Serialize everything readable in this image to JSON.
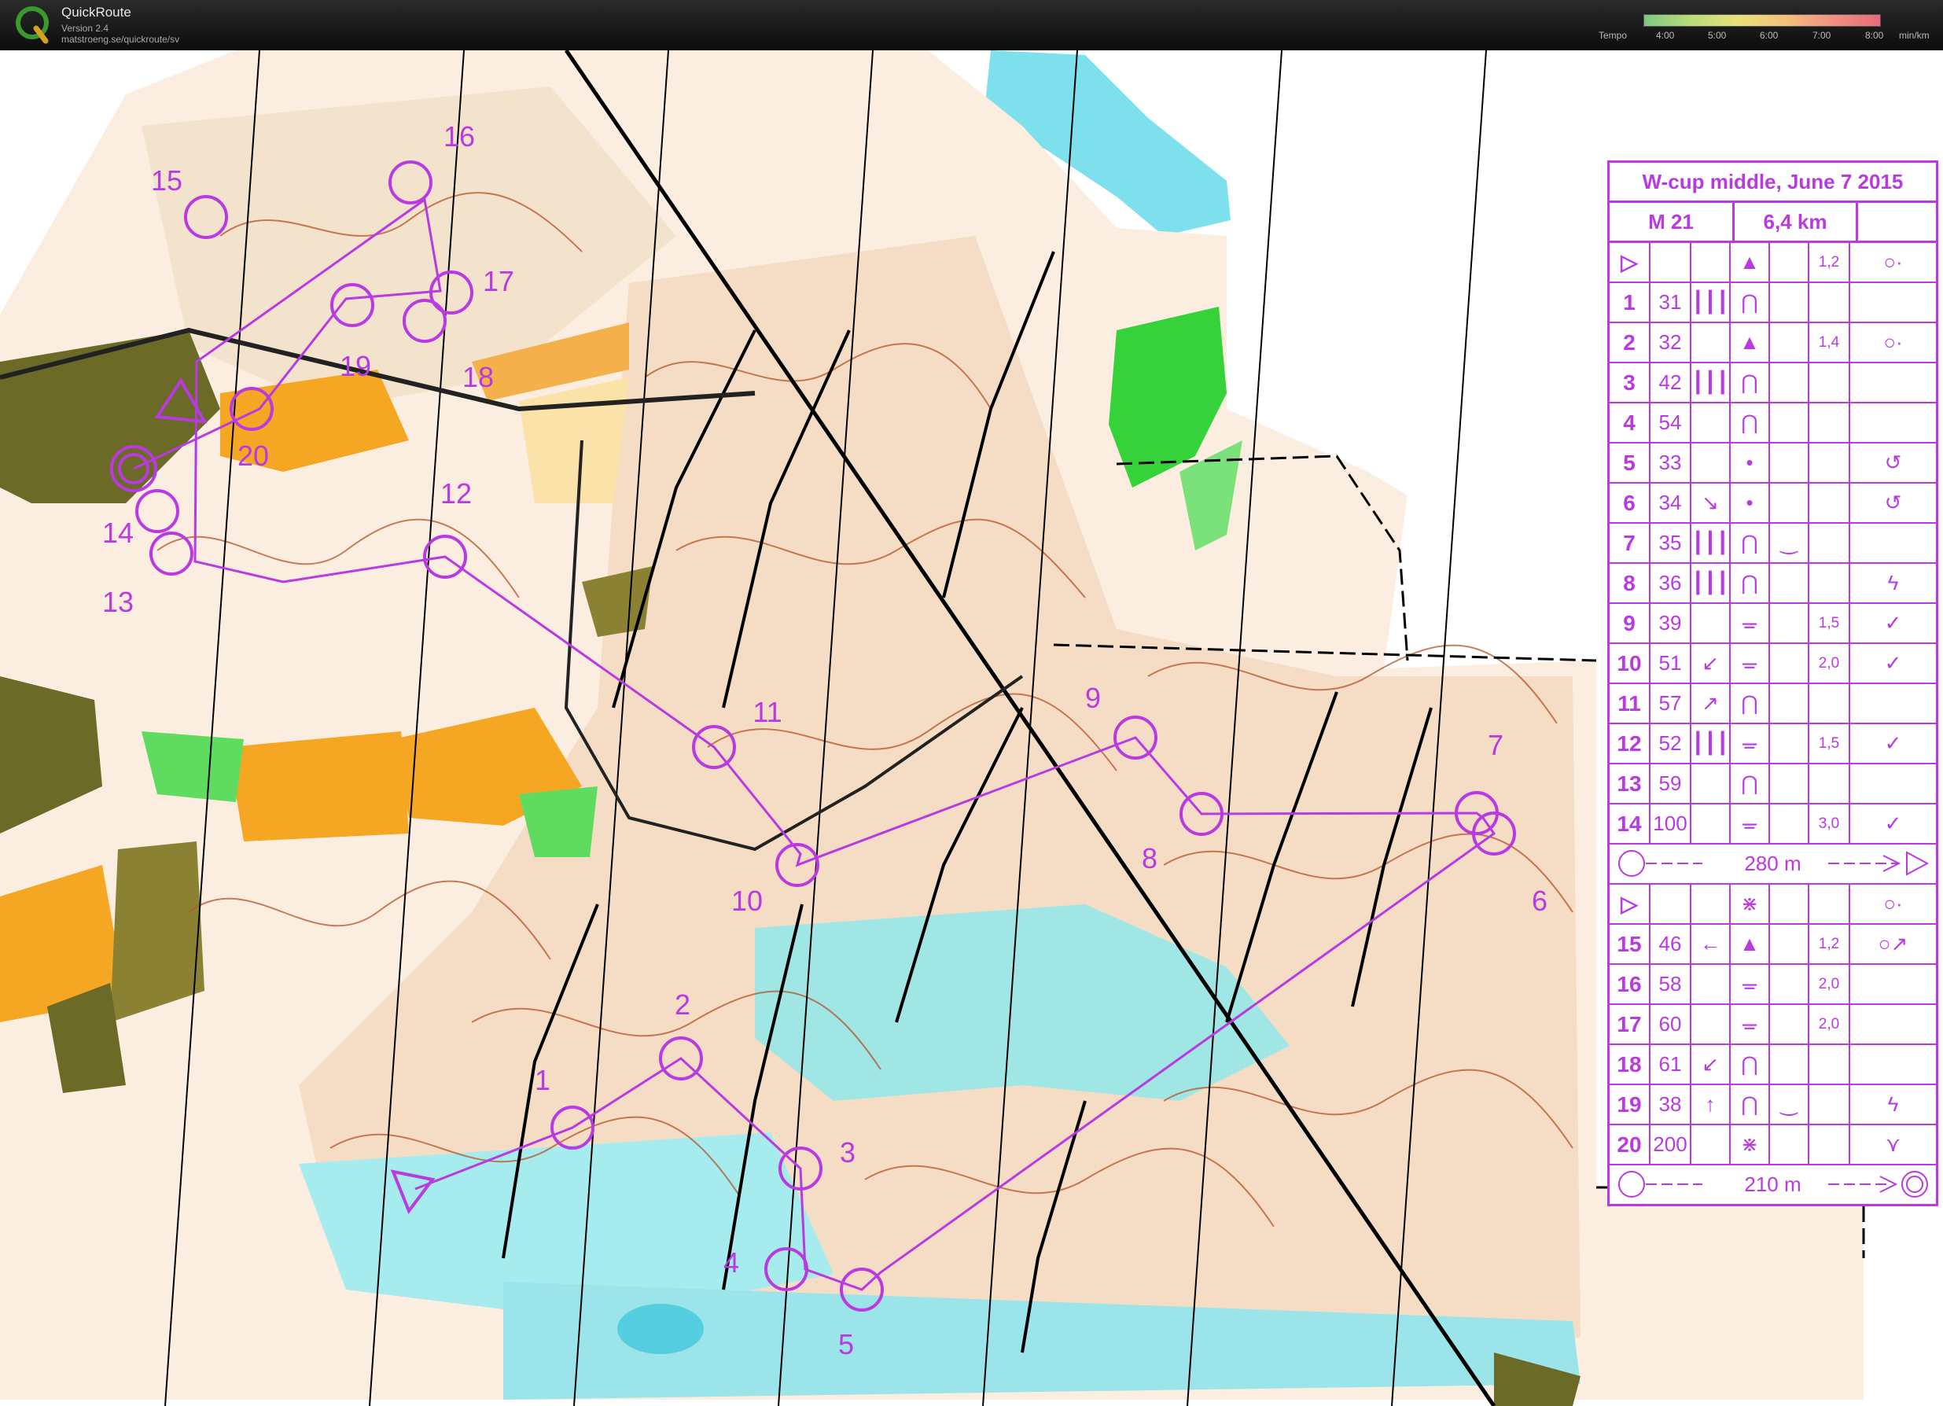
{
  "app": {
    "name": "QuickRoute",
    "version": "Version 2.4",
    "url": "matstroeng.se/quickroute/sv",
    "logo_letter": "Q"
  },
  "tempo": {
    "label": "Tempo",
    "ticks": [
      "4:00",
      "5:00",
      "6:00",
      "7:00",
      "8:00"
    ],
    "unit": "min/km",
    "gradient_colors": [
      "#7fc87f",
      "#b9dc7a",
      "#eae07a",
      "#f4c07a",
      "#f09080",
      "#e86a7a"
    ]
  },
  "map": {
    "colors": {
      "course": "#b83ae0",
      "open_land": "#f5a623",
      "green": "#35d23a",
      "water": "#7ee0ec",
      "urban": "#6b6a26",
      "rock": "#f4ddc4",
      "contour": "#b3542a"
    },
    "controls": [
      {
        "label": "1"
      },
      {
        "label": "2"
      },
      {
        "label": "3"
      },
      {
        "label": "4"
      },
      {
        "label": "5"
      },
      {
        "label": "6"
      },
      {
        "label": "7"
      },
      {
        "label": "8"
      },
      {
        "label": "9"
      },
      {
        "label": "10"
      },
      {
        "label": "11"
      },
      {
        "label": "12"
      },
      {
        "label": "13"
      },
      {
        "label": "14"
      },
      {
        "label": "15"
      },
      {
        "label": "16"
      },
      {
        "label": "17"
      },
      {
        "label": "18"
      },
      {
        "label": "19"
      },
      {
        "label": "20"
      }
    ]
  },
  "description": {
    "title": "W-cup middle, June 7 2015",
    "category": "M 21",
    "length": "6,4 km",
    "start1": {
      "sym": "▷",
      "feature": "▲",
      "dim": "1,2",
      "extra": "○·"
    },
    "rows1": [
      {
        "num": "1",
        "code": "31",
        "which": "┃┃┃",
        "feature": "⋂",
        "appearance": "",
        "dim": "",
        "extra": ""
      },
      {
        "num": "2",
        "code": "32",
        "which": "",
        "feature": "▲",
        "appearance": "",
        "dim": "1,4",
        "extra": "○·"
      },
      {
        "num": "3",
        "code": "42",
        "which": "┃┃┃",
        "feature": "⋂",
        "appearance": "",
        "dim": "",
        "extra": ""
      },
      {
        "num": "4",
        "code": "54",
        "which": "",
        "feature": "⋂",
        "appearance": "",
        "dim": "",
        "extra": ""
      },
      {
        "num": "5",
        "code": "33",
        "which": "",
        "feature": "•",
        "appearance": "",
        "dim": "",
        "extra": "↺"
      },
      {
        "num": "6",
        "code": "34",
        "which": "↘",
        "feature": "•",
        "appearance": "",
        "dim": "",
        "extra": "↺"
      },
      {
        "num": "7",
        "code": "35",
        "which": "┃┃┃",
        "feature": "⋂",
        "appearance": "‿",
        "dim": "",
        "extra": ""
      },
      {
        "num": "8",
        "code": "36",
        "which": "┃┃┃",
        "feature": "⋂",
        "appearance": "",
        "dim": "",
        "extra": "ϟ"
      },
      {
        "num": "9",
        "code": "39",
        "which": "",
        "feature": "ᚚ",
        "appearance": "",
        "dim": "1,5",
        "extra": "✓"
      },
      {
        "num": "10",
        "code": "51",
        "which": "↙",
        "feature": "ᚚ",
        "appearance": "",
        "dim": "2,0",
        "extra": "✓"
      },
      {
        "num": "11",
        "code": "57",
        "which": "↗",
        "feature": "⋂",
        "appearance": "",
        "dim": "",
        "extra": ""
      },
      {
        "num": "12",
        "code": "52",
        "which": "┃┃┃",
        "feature": "ᚚ",
        "appearance": "",
        "dim": "1,5",
        "extra": "✓"
      },
      {
        "num": "13",
        "code": "59",
        "which": "",
        "feature": "⋂",
        "appearance": "",
        "dim": "",
        "extra": ""
      },
      {
        "num": "14",
        "code": "100",
        "which": "",
        "feature": "ᚚ",
        "appearance": "",
        "dim": "3,0",
        "extra": "✓"
      }
    ],
    "leg1": "280 m",
    "start2": {
      "sym": "▷",
      "feature": "⋇",
      "dim": "",
      "extra": "○·"
    },
    "rows2": [
      {
        "num": "15",
        "code": "46",
        "which": "←",
        "feature": "▲",
        "appearance": "",
        "dim": "1,2",
        "extra": "○↗"
      },
      {
        "num": "16",
        "code": "58",
        "which": "",
        "feature": "ᚚ",
        "appearance": "",
        "dim": "2,0",
        "extra": ""
      },
      {
        "num": "17",
        "code": "60",
        "which": "",
        "feature": "ᚚ",
        "appearance": "",
        "dim": "2,0",
        "extra": ""
      },
      {
        "num": "18",
        "code": "61",
        "which": "↙",
        "feature": "⋂",
        "appearance": "",
        "dim": "",
        "extra": ""
      },
      {
        "num": "19",
        "code": "38",
        "which": "↑",
        "feature": "⋂",
        "appearance": "‿",
        "dim": "",
        "extra": "ϟ"
      },
      {
        "num": "20",
        "code": "200",
        "which": "",
        "feature": "⋇",
        "appearance": "",
        "dim": "",
        "extra": "⋎"
      }
    ],
    "leg2": "210 m"
  }
}
